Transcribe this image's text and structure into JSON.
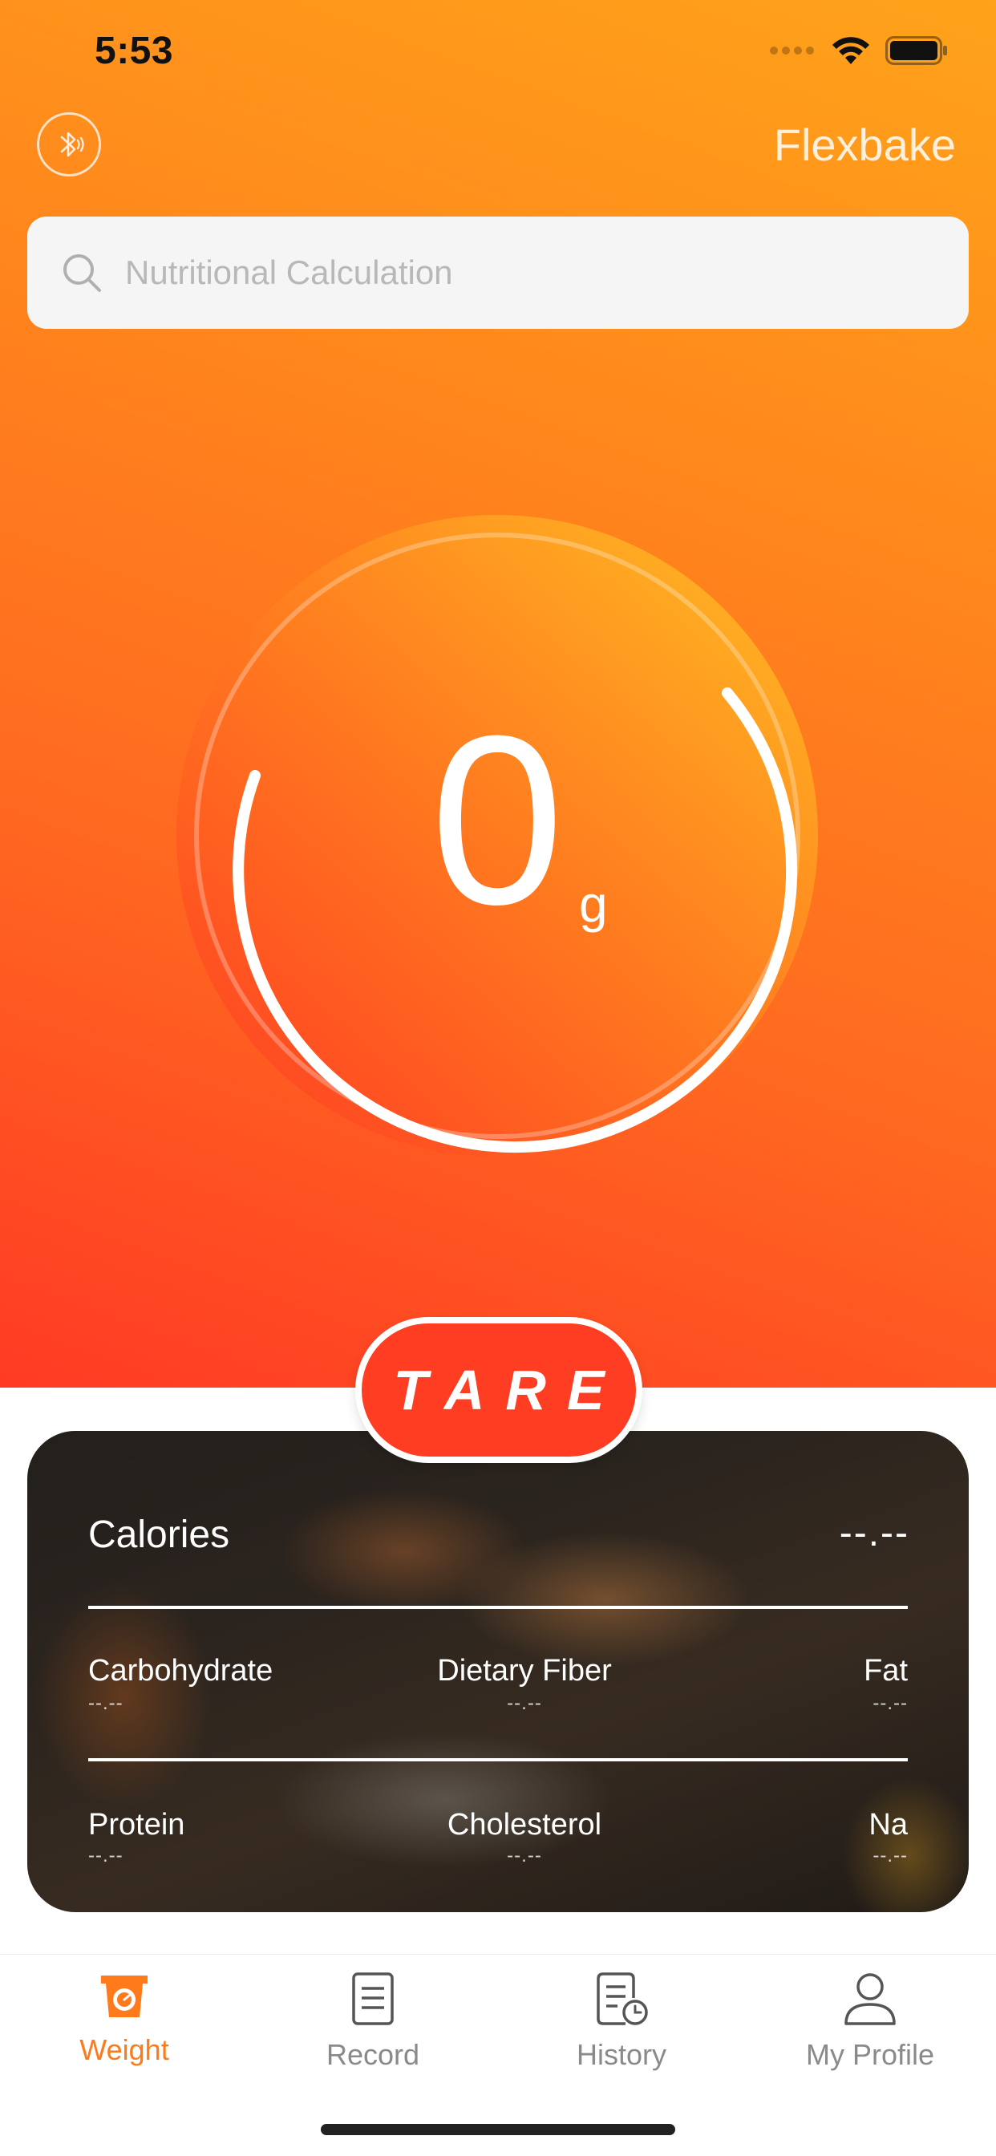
{
  "status_bar": {
    "time": "5:53"
  },
  "header": {
    "brand": "Flexbake",
    "bluetooth_icon": "bluetooth-icon"
  },
  "search": {
    "placeholder": "Nutritional Calculation"
  },
  "scale": {
    "value": "0",
    "unit": "g",
    "progress": 0.85
  },
  "tare": {
    "label": "TARE"
  },
  "nutrition": {
    "calories": {
      "label": "Calories",
      "value": "--.--"
    },
    "row1": [
      {
        "label": "Carbohydrate",
        "value": "--.--"
      },
      {
        "label": "Dietary Fiber",
        "value": "--.--"
      },
      {
        "label": "Fat",
        "value": "--.--"
      }
    ],
    "row2": [
      {
        "label": "Protein",
        "value": "--.--"
      },
      {
        "label": "Cholesterol",
        "value": "--.--"
      },
      {
        "label": "Na",
        "value": "--.--"
      }
    ]
  },
  "tabs": [
    {
      "label": "Weight",
      "icon": "scale-icon",
      "active": true
    },
    {
      "label": "Record",
      "icon": "document-icon",
      "active": false
    },
    {
      "label": "History",
      "icon": "history-icon",
      "active": false
    },
    {
      "label": "My Profile",
      "icon": "person-icon",
      "active": false
    }
  ],
  "colors": {
    "accent": "#ff7a1a",
    "tare": "#ff3d22",
    "gradient_top": "#ffa31a",
    "gradient_bottom": "#ff3a24"
  }
}
